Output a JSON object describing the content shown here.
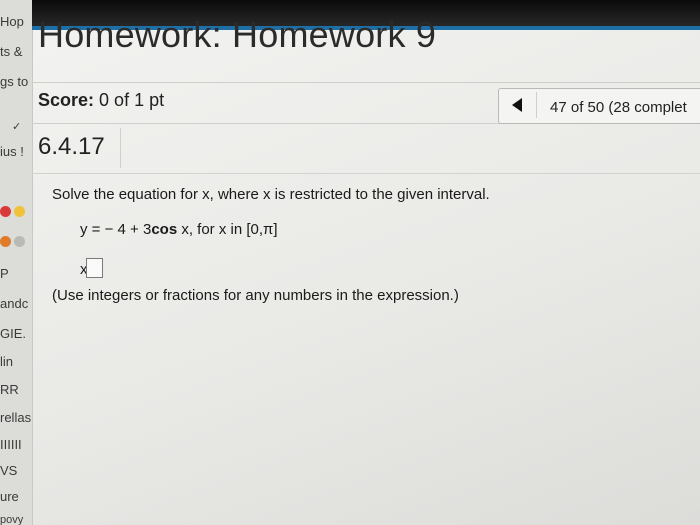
{
  "left_sidebar": {
    "fragments": [
      "Hop",
      "ts &",
      "gs to",
      "✓",
      "ius !",
      "P",
      "andc",
      "GIE.",
      "lin",
      "RR",
      "rellas",
      "IIIIII",
      "VS",
      "ure",
      "povy"
    ],
    "dot_colors": [
      "#d83a3a",
      "#f0c23a",
      "#e07b2a",
      "#b9b9b5"
    ]
  },
  "header": {
    "title": "Homework: Homework 9"
  },
  "score": {
    "label": "Score:",
    "value": "0 of 1 pt"
  },
  "navigator": {
    "prev_icon": "triangle-left-icon",
    "position_text": "47 of 50 (28 complet"
  },
  "question": {
    "number": "6.4.17",
    "prompt": "Solve the equation for x, where x is restricted to the given interval.",
    "equation_before": "y = − 4 + 3",
    "equation_cos": "cos",
    "equation_after": " x, for x in [0,π]",
    "answer_label": "x =",
    "answer_value": "",
    "hint": "(Use integers or fractions for any numbers in the expression.)"
  },
  "colors": {
    "accent_blue": "#1d6fa5",
    "top_bar": "#111111"
  }
}
